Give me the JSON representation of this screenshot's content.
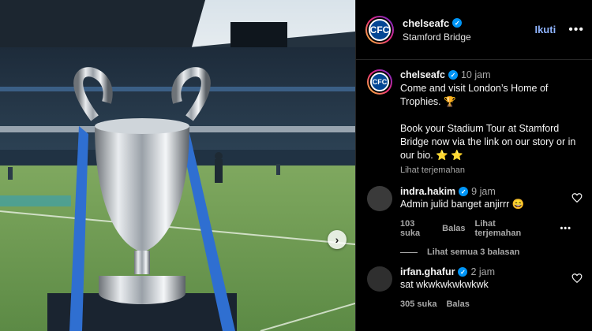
{
  "post": {
    "username": "chelseafc",
    "location": "Stamford Bridge",
    "follow_label": "Ikuti",
    "more_label": "•••"
  },
  "caption": {
    "username": "chelseafc",
    "time": "10 jam",
    "text": "Come and visit London’s Home of Trophies. 🏆\n\nBook your Stadium Tour at Stamford Bridge now via the link on our story or in our bio. ⭐️ ⭐️",
    "translate": "Lihat terjemahan"
  },
  "comments": [
    {
      "username": "indra.hakim",
      "time": "9 jam",
      "text": "Admin julid banget anjirrr 😄",
      "likes": "103 suka",
      "reply": "Balas",
      "translate": "Lihat terjemahan",
      "more": "•••",
      "view_replies": "Lihat semua 3 balasan"
    },
    {
      "username": "irfan.ghafur",
      "time": "2 jam",
      "text": "sat wkwkwkwkwkwk",
      "likes": "305 suka",
      "reply": "Balas"
    }
  ],
  "icons": {
    "verified": "verified-badge-icon",
    "heart": "heart-outline-icon",
    "next": "chevron-right-icon"
  },
  "colors": {
    "accent": "#0095f6",
    "follow": "#8fb4ff",
    "chelsea_blue": "#034694"
  }
}
